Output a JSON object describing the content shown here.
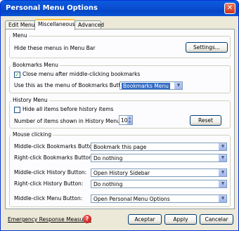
{
  "window": {
    "title": "Personal Menu Options"
  },
  "tabs": [
    {
      "label": "Edit Menus"
    },
    {
      "label": "Miscellaneous"
    },
    {
      "label": "Advanced"
    }
  ],
  "menu_group": {
    "legend": "Menu",
    "text": "Hide these menus in Menu Bar",
    "settings_label": "Settings..."
  },
  "bookmarks_group": {
    "legend": "Bookmarks Menu",
    "close_label": "Close menu after middle-clicking bookmarks",
    "close_checked": true,
    "use_label": "Use this as the menu of Bookmarks Button:",
    "use_value": "Bookmarks Menu"
  },
  "history_group": {
    "legend": "History Menu",
    "hide_label": "Hide all items before history items",
    "hide_checked": false,
    "number_label": "Number of items shown in History Menu:",
    "number_value": "10",
    "reset_label": "Reset"
  },
  "mouse_group": {
    "legend": "Mouse clicking",
    "rows": [
      {
        "label": "Middle-click Bookmarks Button:",
        "value": "Bookmark this page"
      },
      {
        "label": "Right-click Bookmarks Button:",
        "value": "Do nothing"
      },
      {
        "label": "Middle-click History Button:",
        "value": "Open History Sidebar"
      },
      {
        "label": "Right-click History Button:",
        "value": "Do nothing"
      },
      {
        "label": "Middle-click Menu Button:",
        "value": "Open Personal Menu Options"
      }
    ]
  },
  "footer": {
    "emergency_label": "Emergency Response Measures",
    "accept_label": "Aceptar",
    "apply_label": "Apply",
    "cancel_label": "Cancelar"
  },
  "icons": {
    "close": "close-icon",
    "help": "help-icon",
    "dropdown": "chevron-down-icon"
  },
  "colors": {
    "titlebar": "#0a5ddc",
    "active_tab_accent": "#ffc73c",
    "dialog_bg": "#ece9d8",
    "selection": "#316ac5"
  }
}
